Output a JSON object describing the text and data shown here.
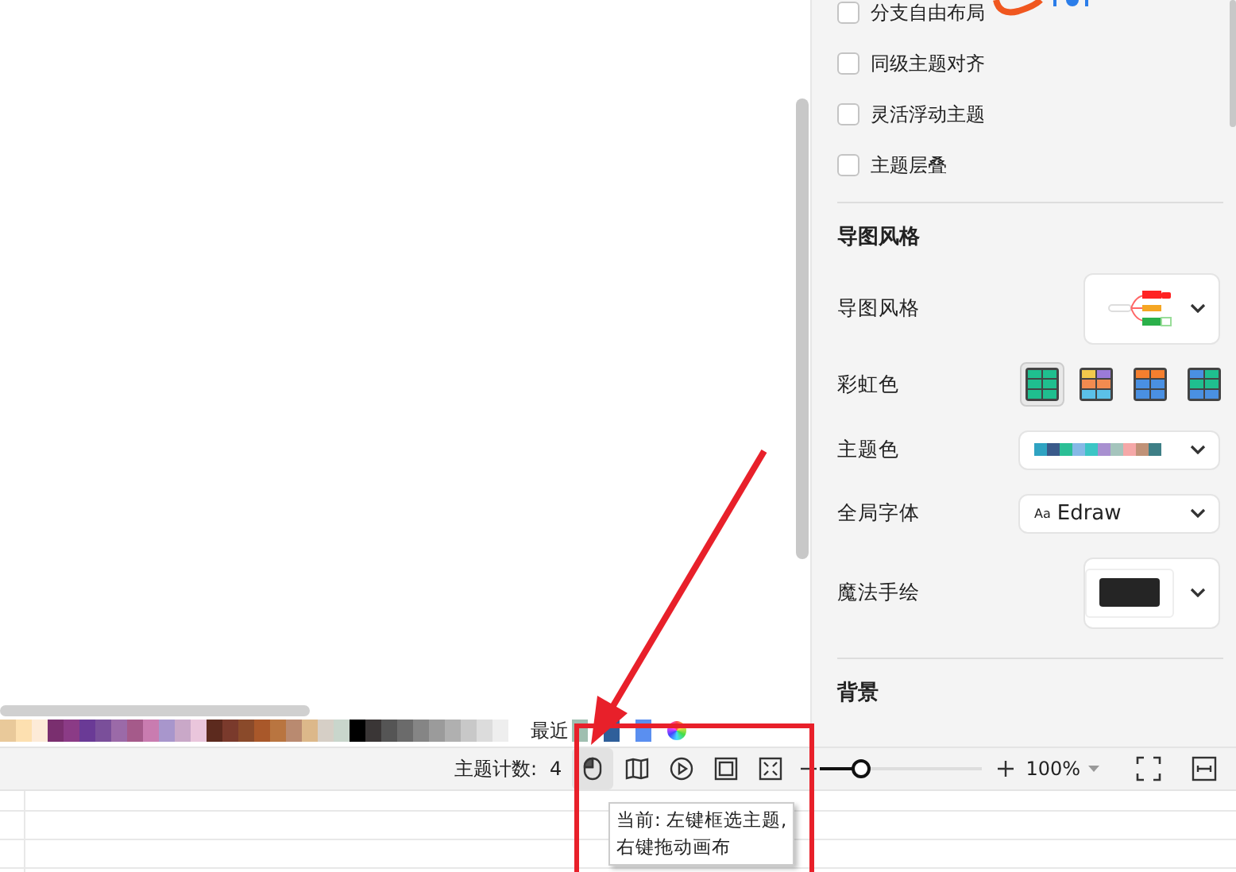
{
  "panel": {
    "checkboxes": [
      {
        "label": "分支自由布局",
        "checked": false
      },
      {
        "label": "同级主题对齐",
        "checked": false
      },
      {
        "label": "灵活浮动主题",
        "checked": false
      },
      {
        "label": "主题层叠",
        "checked": false
      }
    ],
    "section_title": "导图风格",
    "rows": [
      {
        "kind": "style",
        "label": "导图风格"
      },
      {
        "kind": "rainbow",
        "label": "彩虹色",
        "options": [
          {
            "selected": true
          },
          {
            "selected": false
          },
          {
            "selected": false
          },
          {
            "selected": false
          }
        ]
      },
      {
        "kind": "swatches",
        "label": "主题色",
        "colors": [
          {
            "color": "#2fa3c2"
          },
          {
            "color": "#3a5a8a"
          },
          {
            "color": "#2bbf96"
          },
          {
            "color": "#86b8e6"
          },
          {
            "color": "#3cc5c5"
          },
          {
            "color": "#a890d0"
          },
          {
            "color": "#a4c4bc"
          },
          {
            "color": "#f5a8a8"
          },
          {
            "color": "#c09278"
          },
          {
            "color": "#3e7f86"
          }
        ]
      },
      {
        "kind": "font",
        "label": "全局字体",
        "icon_text": "Aa",
        "value": "Edraw"
      },
      {
        "kind": "handdrawn",
        "label": "魔法手绘"
      }
    ],
    "section_title_2": "背景"
  },
  "palette": {
    "colors": [
      {
        "color": "#e9c99a"
      },
      {
        "color": "#fde0b0"
      },
      {
        "color": "#fdebd8"
      },
      {
        "color": "#7a2f6f"
      },
      {
        "color": "#8b3b86"
      },
      {
        "color": "#6a3a96"
      },
      {
        "color": "#7a4f9a"
      },
      {
        "color": "#9b6aa8"
      },
      {
        "color": "#a55a8a"
      },
      {
        "color": "#c97cb0"
      },
      {
        "color": "#a896cc"
      },
      {
        "color": "#c9a8c8"
      },
      {
        "color": "#eac6dc"
      },
      {
        "color": "#5c2a1e"
      },
      {
        "color": "#7a3a2c"
      },
      {
        "color": "#8a4a2a"
      },
      {
        "color": "#a9582a"
      },
      {
        "color": "#b97540"
      },
      {
        "color": "#b98a70"
      },
      {
        "color": "#dcb88a"
      },
      {
        "color": "#d6cfc6"
      },
      {
        "color": "#c9d6cc"
      },
      {
        "color": "#000000"
      },
      {
        "color": "#3a3636"
      },
      {
        "color": "#555555"
      },
      {
        "color": "#6b6b6b"
      },
      {
        "color": "#858585"
      },
      {
        "color": "#9b9b9b"
      },
      {
        "color": "#b0b0b0"
      },
      {
        "color": "#c8c8c8"
      },
      {
        "color": "#dcdcdc"
      },
      {
        "color": "#eeeeee"
      }
    ],
    "recent_label": "最近",
    "recent": [
      {
        "color": "#9fbfb0"
      },
      {
        "color": "#2f5f9a"
      },
      {
        "color": "#5a8ff0"
      }
    ]
  },
  "status_bar": {
    "topic_count_label": "主题计数:",
    "topic_count": "4",
    "tools": [
      {
        "kind": "mouse",
        "selected": true
      },
      {
        "kind": "map",
        "selected": false
      },
      {
        "kind": "play",
        "selected": false
      },
      {
        "kind": "frame",
        "selected": false
      },
      {
        "kind": "expand",
        "selected": false
      }
    ],
    "level": 0.24,
    "zoom": "100%"
  },
  "tooltip": {
    "lines": [
      "当前: 左键框选主题,",
      "右键拖动画布"
    ]
  }
}
